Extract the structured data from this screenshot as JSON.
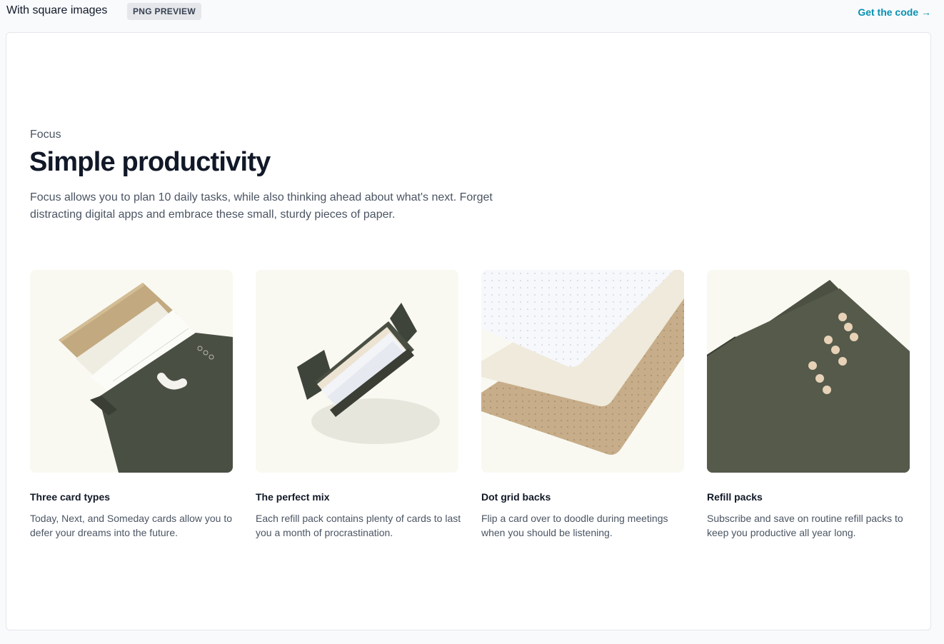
{
  "topbar": {
    "title": "With square images",
    "badge": "PNG PREVIEW",
    "get_code_link": "Get the code →"
  },
  "section": {
    "eyebrow": "Focus",
    "heading": "Simple productivity",
    "lead": "Focus allows you to plan 10 daily tasks, while also thinking ahead about what's next. Forget distracting digital apps and embrace these small, sturdy pieces of paper."
  },
  "features": [
    {
      "title": "Three card types",
      "description": "Today, Next, and Someday cards allow you to defer your dreams into the future."
    },
    {
      "title": "The perfect mix",
      "description": "Each refill pack contains plenty of cards to last you a month of procrastination."
    },
    {
      "title": "Dot grid backs",
      "description": "Flip a card over to doodle during meetings when you should be listening."
    },
    {
      "title": "Refill packs",
      "description": "Subscribe and save on routine refill packs to keep you productive all year long."
    }
  ],
  "colors": {
    "link": "#0891b2",
    "card_green": "#4a4f43",
    "kraft": "#c2a97f",
    "image_bg": "#f9f9f2"
  }
}
